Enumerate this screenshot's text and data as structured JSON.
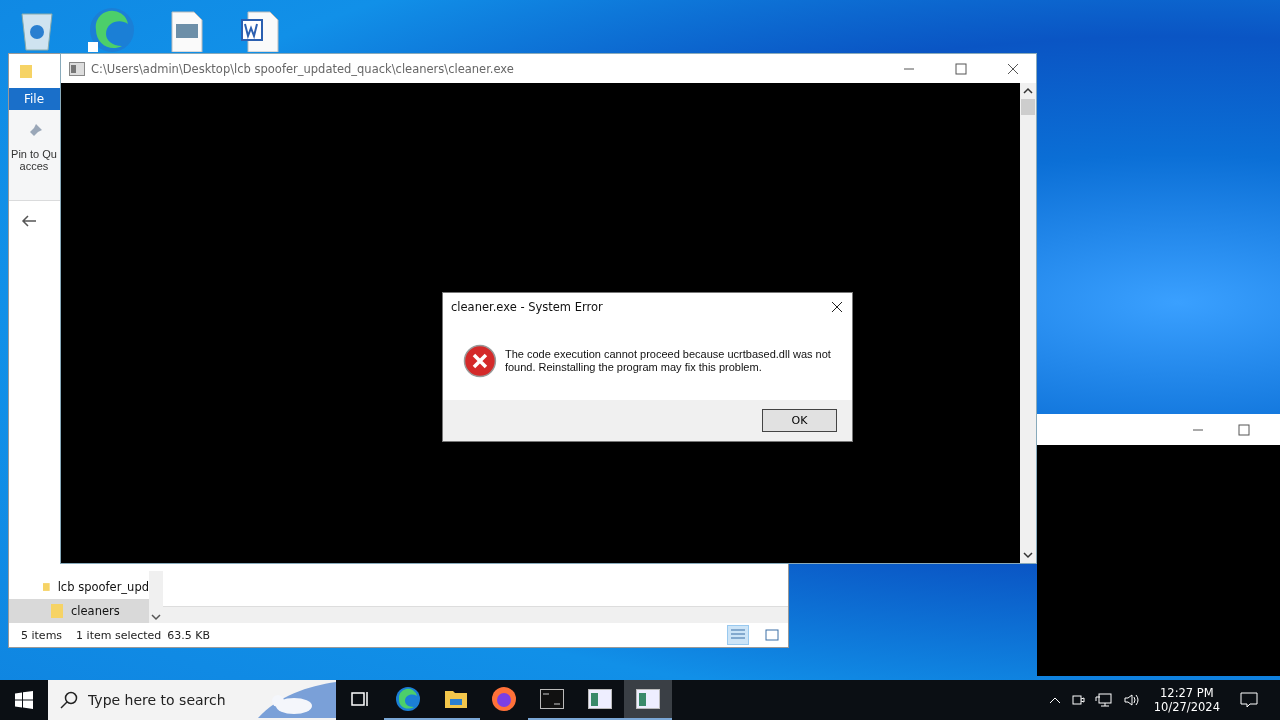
{
  "explorer": {
    "menu_tab": "File",
    "pin_label": [
      "Pin to Qu",
      "acces"
    ],
    "nav_items": [
      {
        "label": "lcb spoofer_upd",
        "selected": false,
        "children": [
          {
            "label": "cleaners",
            "selected": true
          }
        ]
      }
    ],
    "status": {
      "item_count": "5 items",
      "selection": "1 item selected",
      "size": "63.5 KB"
    }
  },
  "console": {
    "title": "C:\\Users\\admin\\Desktop\\lcb spoofer_updated_quack\\cleaners\\cleaner.exe"
  },
  "dialog": {
    "title": "cleaner.exe - System Error",
    "message": "The code execution cannot proceed because ucrtbased.dll was not found. Reinstalling the program may fix this problem.",
    "button": "OK"
  },
  "taskbar": {
    "search_placeholder": "Type here to search",
    "apps": [
      {
        "kind": "taskview",
        "running": false,
        "selected": false
      },
      {
        "kind": "edge",
        "running": true,
        "selected": false
      },
      {
        "kind": "explorer",
        "running": true,
        "selected": false
      },
      {
        "kind": "firefox",
        "running": false,
        "selected": false
      },
      {
        "kind": "console",
        "running": true,
        "selected": false
      },
      {
        "kind": "window",
        "running": true,
        "selected": false
      },
      {
        "kind": "window",
        "running": true,
        "selected": true
      }
    ],
    "time": "12:27 PM",
    "date": "10/27/2024"
  }
}
